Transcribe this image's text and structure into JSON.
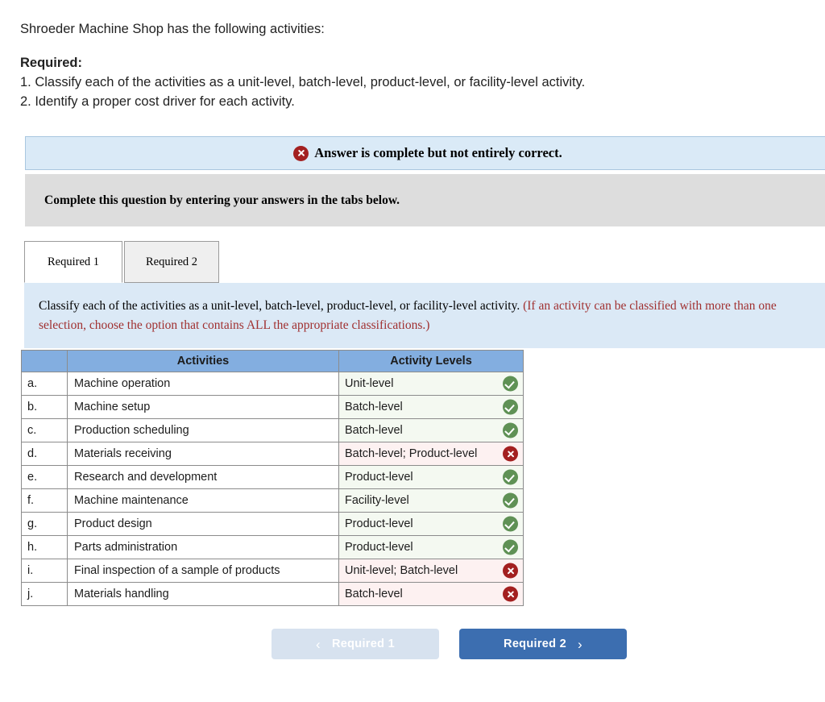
{
  "prompt": {
    "lead": "Shroeder Machine Shop has the following activities:",
    "required_label": "Required:",
    "requirement_1": "1. Classify each of the activities as a unit-level, batch-level, product-level, or facility-level activity.",
    "requirement_2": "2. Identify a proper cost driver for each activity."
  },
  "status_banner": {
    "icon": "x-circle-icon",
    "text": "Answer is complete but not entirely correct."
  },
  "gray_bar": {
    "text": "Complete this question by entering your answers in the tabs below."
  },
  "tabs": [
    {
      "label": "Required 1",
      "active": true
    },
    {
      "label": "Required 2",
      "active": false
    }
  ],
  "instruction": {
    "main": "Classify each of the activities as a unit-level, batch-level, product-level, or facility-level activity. ",
    "hint": "(If an activity can be classified with more than one selection, choose the option that contains ALL the appropriate classifications.)"
  },
  "table": {
    "headers": {
      "index": "",
      "activities": "Activities",
      "levels": "Activity Levels"
    },
    "rows": [
      {
        "index": "a.",
        "activity": "Machine operation",
        "level": "Unit-level",
        "status": "correct"
      },
      {
        "index": "b.",
        "activity": "Machine setup",
        "level": "Batch-level",
        "status": "correct"
      },
      {
        "index": "c.",
        "activity": "Production scheduling",
        "level": "Batch-level",
        "status": "correct"
      },
      {
        "index": "d.",
        "activity": "Materials receiving",
        "level": "Batch-level; Product-level",
        "status": "wrong"
      },
      {
        "index": "e.",
        "activity": "Research and development",
        "level": "Product-level",
        "status": "correct"
      },
      {
        "index": "f.",
        "activity": "Machine maintenance",
        "level": "Facility-level",
        "status": "correct"
      },
      {
        "index": "g.",
        "activity": "Product design",
        "level": "Product-level",
        "status": "correct"
      },
      {
        "index": "h.",
        "activity": "Parts administration",
        "level": "Product-level",
        "status": "correct"
      },
      {
        "index": "i.",
        "activity": "Final inspection of a sample of products",
        "level": "Unit-level; Batch-level",
        "status": "wrong"
      },
      {
        "index": "j.",
        "activity": "Materials handling",
        "level": "Batch-level",
        "status": "wrong"
      }
    ]
  },
  "nav": {
    "prev_label": "Required 1",
    "prev_chevron": "‹",
    "next_label": "Required 2",
    "next_chevron": "›"
  },
  "colors": {
    "header_blue": "#83aee0",
    "banner_blue": "#daeaf7",
    "gray_bar": "#dddddd",
    "correct_green": "#5f9155",
    "wrong_red": "#a32020",
    "next_button_blue": "#3c6eb0",
    "prev_button_blue": "#d7e2ef"
  }
}
